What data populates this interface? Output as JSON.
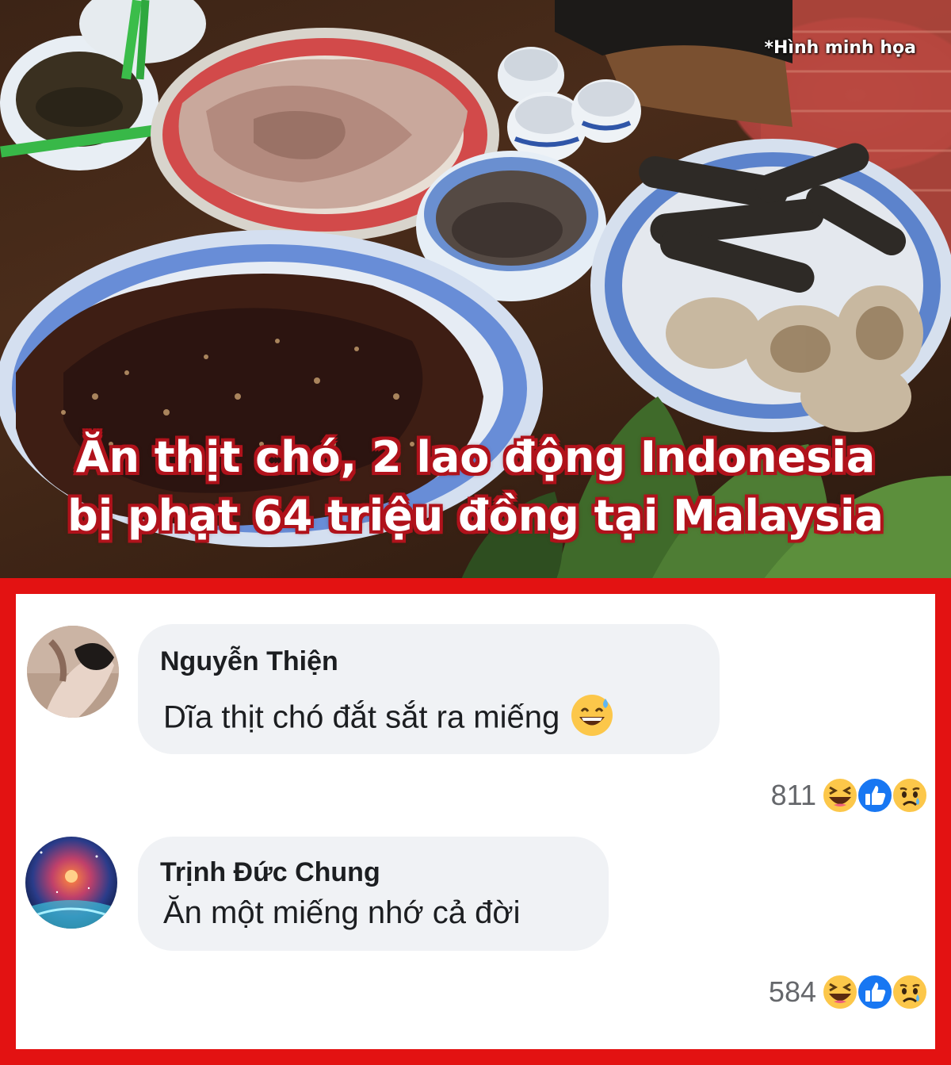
{
  "photo": {
    "note": "*Hình minh họa",
    "headline_line1": "Ăn thịt chó, 2 lao động Indonesia",
    "headline_line2": "bị phạt 64 triệu đồng tại Malaysia"
  },
  "comments": [
    {
      "author": "Nguyễn Thiện",
      "text": "Dĩa thịt chó đắt sắt ra miếng",
      "inline_emoji": "grinning-face-with-sweat-icon",
      "reaction_count": "811",
      "reactions": [
        "haha-icon",
        "like-icon",
        "sad-icon"
      ]
    },
    {
      "author": "Trịnh Đức Chung",
      "text": "Ăn một miếng nhớ cả đời",
      "reaction_count": "584",
      "reactions": [
        "haha-icon",
        "like-icon",
        "sad-icon"
      ]
    }
  ],
  "colors": {
    "frame": "#e31212",
    "headline_outline": "#b0121b",
    "bubble": "#f0f2f5",
    "like_blue": "#1877f2",
    "emoji_yellow": "#fcc74a"
  }
}
